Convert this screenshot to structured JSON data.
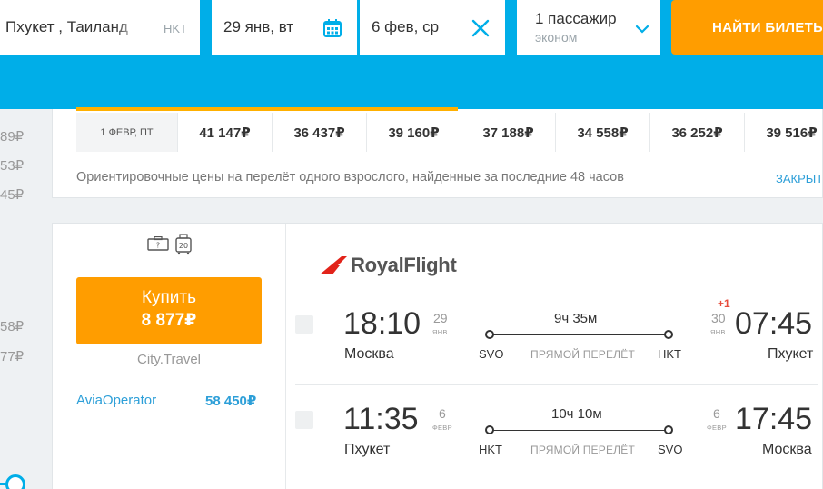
{
  "search": {
    "destination": "Пхукет , Таиланд",
    "destination_code": "HKT",
    "date_depart": "29 янв, вт",
    "date_return": "6 фев, ср",
    "passengers": "1 пассажир",
    "cabin": "эконом",
    "search_button": "НАЙТИ БИЛЕТЫ"
  },
  "left_prices": [
    "89₽",
    "53₽",
    "45₽",
    "58₽",
    "77₽"
  ],
  "price_calendar": {
    "selected_day": "1 ФЕВР, ПТ",
    "prices": [
      "41 147₽",
      "36 437₽",
      "39 160₽",
      "37 188₽",
      "34 558₽",
      "36 252₽",
      "39 516₽"
    ],
    "note": "Ориентировочные цены на перелёт одного взрослого, найденные за последние 48 часов",
    "close_label": "ЗАКРЫТЬ"
  },
  "ticket": {
    "baggage_icons": [
      "?",
      "20"
    ],
    "buy_label": "Купить",
    "price": "8 877₽",
    "agency": "City.Travel",
    "alt_agency": "AviaOperator",
    "alt_price": "58 450₽",
    "airline": "RoyalFlight",
    "segments": [
      {
        "dep_time": "18:10",
        "dep_day": "29",
        "dep_month": "ЯНВ",
        "dep_city": "Москва",
        "dep_code": "SVO",
        "duration": "9ч 35м",
        "type": "ПРЯМОЙ ПЕРЕЛЁТ",
        "arr_time": "07:45",
        "arr_day": "30",
        "arr_month": "ЯНВ",
        "arr_city": "Пхукет",
        "arr_code": "HKT",
        "day_shift": "+1"
      },
      {
        "dep_time": "11:35",
        "dep_day": "6",
        "dep_month": "ФЕВР",
        "dep_city": "Пхукет",
        "dep_code": "HKT",
        "duration": "10ч 10м",
        "type": "ПРЯМОЙ ПЕРЕЛЁТ",
        "arr_time": "17:45",
        "arr_day": "6",
        "arr_month": "ФЕВР",
        "arr_city": "Москва",
        "arr_code": "SVO",
        "day_shift": ""
      }
    ]
  },
  "colors": {
    "accent": "#00aee8",
    "button": "#ff9d00",
    "link": "#2d9fd8",
    "airline_red": "#e2231a"
  }
}
